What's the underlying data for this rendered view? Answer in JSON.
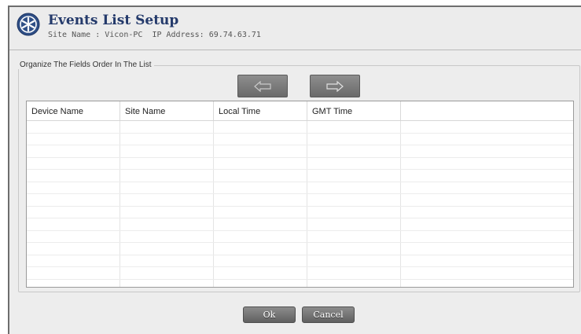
{
  "header": {
    "title": "Events List Setup",
    "site_label": "Site Name : Vicon-PC",
    "ip_label": "IP Address: 69.74.63.71",
    "logo_icon": "vicon-logo-icon"
  },
  "group": {
    "legend": "Organize The Fields Order In The List",
    "move_left_icon": "arrow-left-icon",
    "move_right_icon": "arrow-right-icon"
  },
  "table": {
    "columns": [
      "Device Name",
      "Site Name",
      "Local Time",
      "GMT Time",
      ""
    ],
    "rows": []
  },
  "footer": {
    "ok_label": "Ok",
    "cancel_label": "Cancel"
  },
  "colors": {
    "title": "#243a6b",
    "button": "#6a6a6a",
    "background": "#ededed"
  }
}
